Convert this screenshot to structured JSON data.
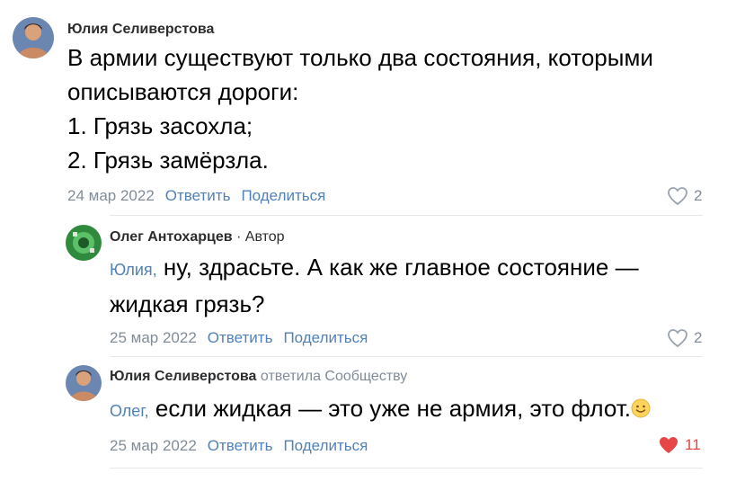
{
  "comments": [
    {
      "author": "Юлия Селиверстова",
      "lines": [
        "В армии существуют только два состояния, которыми",
        "описываются дороги:",
        "1. Грязь засохла;",
        "2. Грязь замёрзла."
      ],
      "date": "24 мар 2022",
      "reply_label": "Ответить",
      "share_label": "Поделиться",
      "likes": "2",
      "liked": false
    },
    {
      "author": "Олег Антохарцев",
      "author_badge": "· Автор",
      "mention": "Юлия,",
      "line1": " ну, здрасьте. А как же главное состояние —",
      "line2": "жидкая грязь?",
      "date": "25 мар 2022",
      "reply_label": "Ответить",
      "share_label": "Поделиться",
      "likes": "2",
      "liked": false
    },
    {
      "author": "Юлия Селиверстова",
      "author_note": "ответила Сообществу",
      "mention": "Олег,",
      "line1": " если жидкая — это уже не армия, это флот.",
      "emoji": "smile-emoji",
      "date": "25 мар 2022",
      "reply_label": "Ответить",
      "share_label": "Поделиться",
      "likes": "11",
      "liked": true
    }
  ],
  "colors": {
    "link": "#5181b8",
    "muted": "#818c99",
    "liked": "#e64646"
  }
}
